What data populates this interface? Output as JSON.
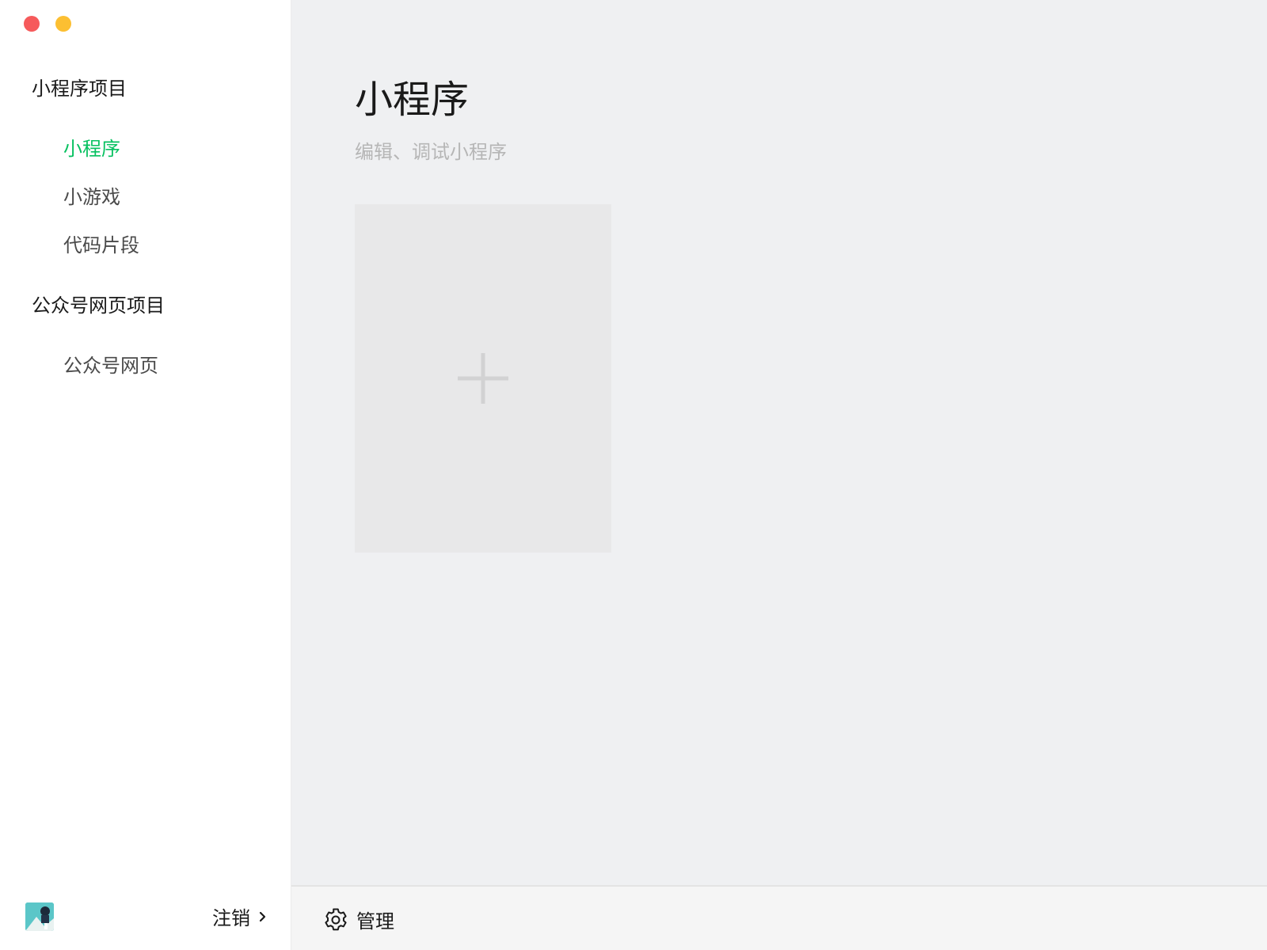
{
  "window": {
    "controls": [
      "close",
      "minimize"
    ]
  },
  "sidebar": {
    "sections": [
      {
        "title": "小程序项目",
        "items": [
          {
            "label": "小程序",
            "active": true
          },
          {
            "label": "小游戏",
            "active": false
          },
          {
            "label": "代码片段",
            "active": false
          }
        ]
      },
      {
        "title": "公众号网页项目",
        "items": [
          {
            "label": "公众号网页",
            "active": false
          }
        ]
      }
    ],
    "footer": {
      "logout_label": "注销",
      "avatar_icon": "user-avatar"
    }
  },
  "main": {
    "title": "小程序",
    "subtitle": "编辑、调试小程序",
    "new_card_icon": "plus-icon",
    "footer": {
      "manage_label": "管理",
      "manage_icon": "gear-icon"
    }
  },
  "colors": {
    "accent": "#07c160",
    "close": "#f65a5b",
    "minimize": "#fcbf32",
    "main_bg": "#eff0f2",
    "card_bg": "#e8e8e9"
  }
}
